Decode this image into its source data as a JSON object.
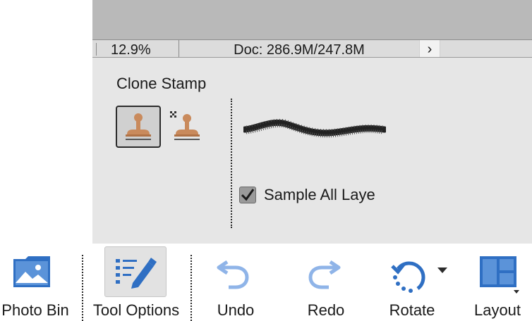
{
  "status": {
    "zoom": "12.9%",
    "doc": "Doc: 286.9M/247.8M",
    "arrow": "›"
  },
  "tool_options": {
    "title": "Clone Stamp",
    "clone_stamp_icon": "clone-stamp-icon",
    "pattern_stamp_icon": "pattern-stamp-icon",
    "sample_all_layers_label": "Sample All Laye",
    "sample_all_layers_checked": true
  },
  "taskbar": {
    "items": [
      {
        "label": "Photo Bin",
        "icon": "photo-bin-icon"
      },
      {
        "label": "Tool Options",
        "icon": "tool-options-icon",
        "active": true
      },
      {
        "label": "Undo",
        "icon": "undo-icon"
      },
      {
        "label": "Redo",
        "icon": "redo-icon"
      },
      {
        "label": "Rotate",
        "icon": "rotate-icon"
      },
      {
        "label": "Layout",
        "icon": "layout-icon"
      }
    ]
  },
  "colors": {
    "accent_blue": "#2f6fc3",
    "stamp_tan": "#c98a5c",
    "panel_gray": "#e6e6e6"
  }
}
